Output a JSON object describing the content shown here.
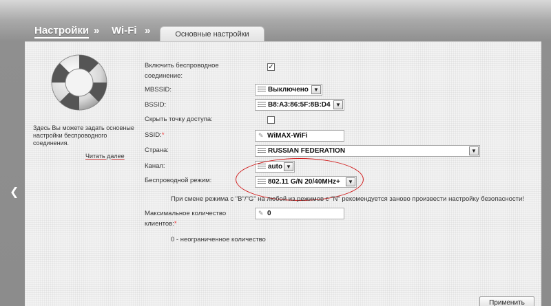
{
  "breadcrumb": {
    "home": "Настройки",
    "separator": "»",
    "section": "Wi-Fi",
    "tab": "Основные настройки"
  },
  "sidebar": {
    "help_text": "Здесь Вы можете задать основные настройки беспроводного соединения.",
    "read_more": "Читать далее",
    "icon": "lifebuoy-icon"
  },
  "form": {
    "enable_wireless": {
      "label": "Включить беспроводное соединение:",
      "checked": true,
      "mark": "✓"
    },
    "mbssid": {
      "label": "MBSSID:",
      "value": "Выключено"
    },
    "bssid": {
      "label": "BSSID:",
      "value": "B8:A3:86:5F:8B:D4"
    },
    "hide_ap": {
      "label": "Скрыть точку доступа:",
      "checked": false
    },
    "ssid": {
      "label": "SSID:",
      "required": "*",
      "value": "WiMAX-WiFi"
    },
    "country": {
      "label": "Страна:",
      "value": "RUSSIAN FEDERATION"
    },
    "channel": {
      "label": "Канал:",
      "value": "auto"
    },
    "mode": {
      "label": "Беспроводной режим:",
      "value": "802.11 G/N 20/40MHz+"
    },
    "mode_note": "При смене режима с \"B\"/\"G\" на любой из режимов с \"N\" рекомендуется заново произвести настройку безопасности!",
    "max_clients": {
      "label": "Максимальное количество клиентов:",
      "required": "*",
      "value": "0"
    },
    "max_clients_note": "0 - неограниченное количество"
  },
  "actions": {
    "apply": "Применить"
  },
  "colors": {
    "highlight": "#d01818",
    "required": "#e33333"
  }
}
